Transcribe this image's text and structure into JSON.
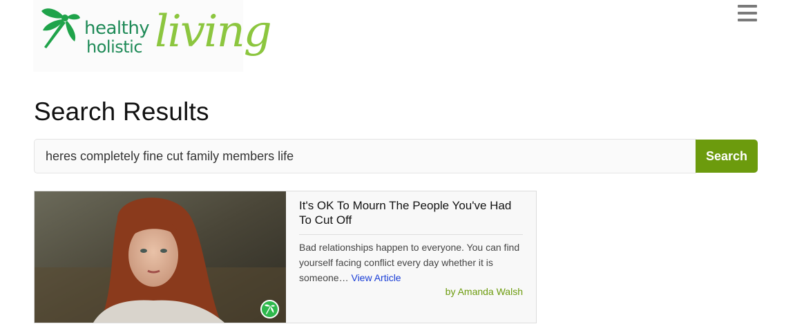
{
  "logo": {
    "word1": "healthy",
    "word2": "holistic",
    "word3": "living",
    "icon": "dragonfly-icon"
  },
  "menu": {
    "icon": "hamburger-menu-icon"
  },
  "page": {
    "title": "Search Results"
  },
  "search": {
    "value": "heres completely fine cut family members life",
    "button_label": "Search"
  },
  "results": [
    {
      "title": "It's OK To Mourn The People You've Had To Cut Off",
      "excerpt": "Bad relationships happen to everyone. You can find yourself facing conflict every day whether it is someone…",
      "link_label": "View Article",
      "author": "by Amanda Walsh",
      "badge_icon": "dragonfly-badge-icon"
    }
  ],
  "colors": {
    "brand_green": "#1e8a57",
    "lime": "#8cc63f",
    "button": "#6c9b0d",
    "link": "#1a3ed6"
  }
}
